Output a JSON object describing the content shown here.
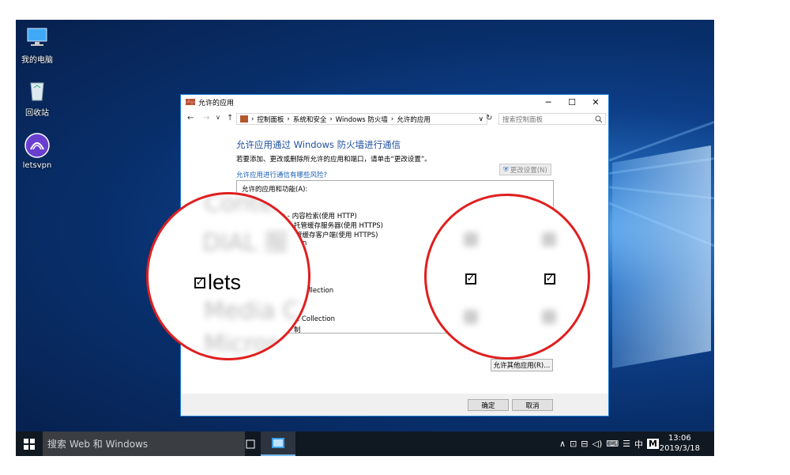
{
  "desktop": {
    "icons": [
      {
        "label": "我的电脑",
        "icon": "computer-icon"
      },
      {
        "label": "回收站",
        "icon": "recycle-bin-icon"
      },
      {
        "label": "letsvpn",
        "icon": "letsvpn-icon"
      }
    ]
  },
  "window": {
    "title": "允许的应用",
    "controls": {
      "minimize": "─",
      "maximize": "☐",
      "close": "✕"
    },
    "address": {
      "back": "←",
      "forward": "→",
      "history": "∨",
      "up": "↑",
      "crumbs": [
        "控制面板",
        "系统和安全",
        "Windows 防火墙",
        "允许的应用"
      ],
      "separator": "›",
      "refresh": "↻"
    },
    "search_placeholder": "搜索控制面板",
    "heading": "允许应用通过 Windows 防火墙进行通信",
    "description": "若要添加、更改或删除所允许的应用和端口，请单击“更改设置”。",
    "risk_link": "允许应用进行通信有哪些风险?",
    "change_settings": "更改设置(N)",
    "list_header": "允许的应用和功能(A):",
    "rows": [
      "e - 内容检索(使用 HTTP)",
      "托管缓存服务器(使用 HTTPS)",
      "管缓存客户端(使用 HTTPS)",
      "tion",
      "ollection",
      "e Collection",
      "制"
    ],
    "allow_other": "允许其他应用(R)...",
    "ok": "确定",
    "cancel": "取消"
  },
  "zoom_left": {
    "blur_lines": [
      "Content",
      "DIAL 服",
      "Media C",
      "Micros"
    ],
    "app_name": "lets",
    "checked": true
  },
  "zoom_right": {
    "private_checked": true,
    "public_checked": true
  },
  "taskbar": {
    "search_text": "搜索 Web 和 Windows",
    "tray_icons": [
      "∧",
      "⊡",
      "⊟",
      "◁)",
      "⌨",
      "☰"
    ],
    "ime_text": "中",
    "ime_icon": "M",
    "time": "13:06",
    "date": "2019/3/18"
  },
  "colors": {
    "highlight": "#e01f1f",
    "accent": "#1e4f9c",
    "link": "#1a5fb4"
  }
}
